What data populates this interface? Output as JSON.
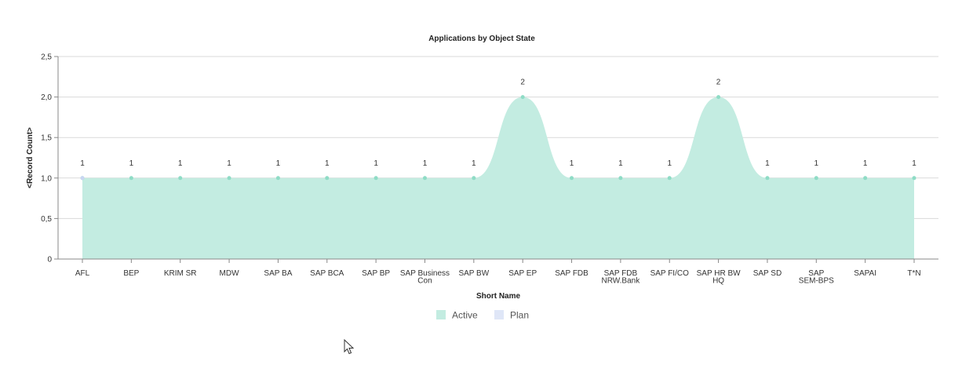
{
  "chart_data": {
    "type": "area",
    "title": "Applications by Object State",
    "xlabel": "Short Name",
    "ylabel": "<Record Count>",
    "ylim": [
      0,
      2.5
    ],
    "yticks": [
      "0",
      "0,5",
      "1,0",
      "1,5",
      "2,0",
      "2,5"
    ],
    "ytick_values": [
      0,
      0.5,
      1.0,
      1.5,
      2.0,
      2.5
    ],
    "categories": [
      [
        "AFL"
      ],
      [
        "BEP"
      ],
      [
        "KRIM SR"
      ],
      [
        "MDW"
      ],
      [
        "SAP BA"
      ],
      [
        "SAP BCA"
      ],
      [
        "SAP BP"
      ],
      [
        "SAP Business",
        "Con"
      ],
      [
        "SAP BW"
      ],
      [
        "SAP EP"
      ],
      [
        "SAP FDB"
      ],
      [
        "SAP FDB",
        "NRW.Bank"
      ],
      [
        "SAP FI/CO"
      ],
      [
        "SAP HR BW",
        "HQ"
      ],
      [
        "SAP SD"
      ],
      [
        "SAP",
        "SEM-BPS"
      ],
      [
        "SAPAI"
      ],
      [
        "T*N"
      ]
    ],
    "series": [
      {
        "name": "Active",
        "color": "#c3ece1",
        "point_color": "#8fdcc6",
        "values": [
          1,
          1,
          1,
          1,
          1,
          1,
          1,
          1,
          1,
          2,
          1,
          1,
          1,
          2,
          1,
          1,
          1,
          1
        ],
        "labels": [
          "1",
          "1",
          "1",
          "1",
          "1",
          "1",
          "1",
          "1",
          "1",
          "2",
          "1",
          "1",
          "1",
          "2",
          "1",
          "1",
          "1",
          "1"
        ]
      },
      {
        "name": "Plan",
        "color": "#dfe6f7",
        "point_color": "#c9d6f2",
        "values": [
          1
        ],
        "labels": []
      }
    ],
    "legend": "bottom-center",
    "grid": true
  }
}
